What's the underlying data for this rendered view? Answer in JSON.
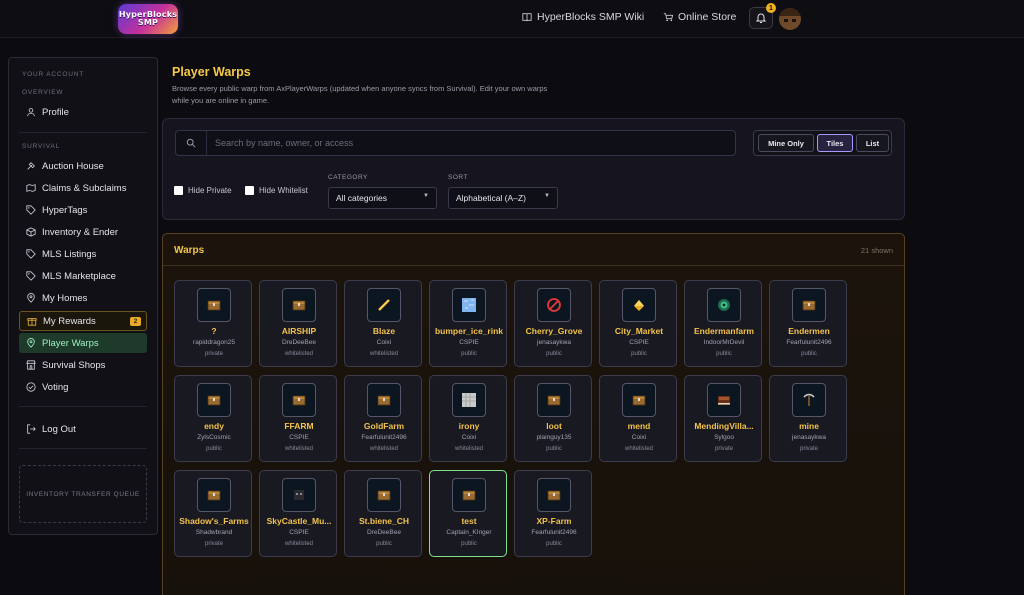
{
  "header": {
    "logo_text": "HyperBlocks SMP",
    "wiki_link": "HyperBlocks SMP Wiki",
    "store_link": "Online Store",
    "notification_count": "1"
  },
  "sidebar": {
    "account_heading": "Your Account",
    "overview_heading": "Overview",
    "profile": "Profile",
    "survival_heading": "Survival",
    "items": [
      {
        "label": "Auction House",
        "icon": "hammer-icon"
      },
      {
        "label": "Claims & Subclaims",
        "icon": "map-icon"
      },
      {
        "label": "HyperTags",
        "icon": "tag-icon"
      },
      {
        "label": "Inventory & Ender",
        "icon": "cube-icon"
      },
      {
        "label": "MLS Listings",
        "icon": "tag-icon"
      },
      {
        "label": "MLS Marketplace",
        "icon": "tag-icon"
      },
      {
        "label": "My Homes",
        "icon": "pin-icon"
      },
      {
        "label": "My Rewards",
        "icon": "gift-icon",
        "badge": "2"
      },
      {
        "label": "Player Warps",
        "icon": "pin-icon",
        "active": true
      },
      {
        "label": "Survival Shops",
        "icon": "shop-icon"
      },
      {
        "label": "Voting",
        "icon": "check-circle-icon"
      }
    ],
    "logout": "Log Out",
    "transfer_queue": "Inventory Transfer Queue"
  },
  "main": {
    "title": "Player Warps",
    "description": "Browse every public warp from AxPlayerWarps (updated when anyone syncs from Survival). Edit your own warps while you are online in game.",
    "search_placeholder": "Search by name, owner, or access",
    "view_buttons": {
      "mine_only": "Mine Only",
      "tiles": "Tiles",
      "list": "List",
      "active": "Tiles"
    },
    "hide_private": "Hide Private",
    "hide_whitelist": "Hide Whitelist",
    "category_label": "Category",
    "category_value": "All categories",
    "sort_label": "Sort",
    "sort_value": "Alphabetical (A–Z)"
  },
  "warps": {
    "title": "Warps",
    "count": "21 shown",
    "items": [
      {
        "name": "?",
        "owner": "rapiddragon25",
        "access": "private",
        "icon": "chest-icon"
      },
      {
        "name": "AIRSHIP",
        "owner": "DreDeeBee",
        "access": "whitelisted",
        "icon": "chest-icon"
      },
      {
        "name": "Blaze",
        "owner": "Coixi",
        "access": "whitelisted",
        "icon": "blaze-rod-icon"
      },
      {
        "name": "bumper_ice_rink",
        "owner": "CSPIE",
        "access": "public",
        "icon": "ice-block-icon"
      },
      {
        "name": "Cherry_Grove",
        "owner": "jenasaykwa",
        "access": "public",
        "icon": "barrier-icon"
      },
      {
        "name": "City_Market",
        "owner": "CSPIE",
        "access": "public",
        "icon": "gold-icon"
      },
      {
        "name": "Endermanfarm",
        "owner": "IndoorMrDevil",
        "access": "public",
        "icon": "ender-eye-icon"
      },
      {
        "name": "Endermen",
        "owner": "Fearfulunit2496",
        "access": "public",
        "icon": "chest-icon"
      },
      {
        "name": "endy",
        "owner": "ZylsCosmic",
        "access": "public",
        "icon": "chest-icon"
      },
      {
        "name": "FFARM",
        "owner": "CSPIE",
        "access": "whitelisted",
        "icon": "chest-icon"
      },
      {
        "name": "GoldFarm",
        "owner": "Fearfulunit2496",
        "access": "whitelisted",
        "icon": "chest-icon"
      },
      {
        "name": "irony",
        "owner": "Coixi",
        "access": "whitelisted",
        "icon": "iron-block-icon"
      },
      {
        "name": "loot",
        "owner": "plainguy135",
        "access": "public",
        "icon": "chest-icon"
      },
      {
        "name": "mend",
        "owner": "Coixi",
        "access": "whitelisted",
        "icon": "chest-icon"
      },
      {
        "name": "MendingVilla...",
        "owner": "Sylgoo",
        "access": "private",
        "icon": "book-icon"
      },
      {
        "name": "mine",
        "owner": "jenasaykwa",
        "access": "private",
        "icon": "pickaxe-icon"
      },
      {
        "name": "Shadow's_Farms",
        "owner": "Shadwbrand",
        "access": "private",
        "icon": "chest-icon"
      },
      {
        "name": "SkyCastle_Mu...",
        "owner": "CSPIE",
        "access": "whitelisted",
        "icon": "skull-icon"
      },
      {
        "name": "St.biene_CH",
        "owner": "DreDeeBee",
        "access": "public",
        "icon": "chest-icon"
      },
      {
        "name": "test",
        "owner": "Captain_KInger",
        "access": "public",
        "icon": "chest-icon",
        "highlight": true
      },
      {
        "name": "XP-Farm",
        "owner": "Fearfulunit2496",
        "access": "public",
        "icon": "chest-icon"
      }
    ]
  },
  "colors": {
    "accent_gold": "#f3c64a",
    "active_green": "#9ff0bf",
    "tile_highlight": "#7ee28a"
  }
}
